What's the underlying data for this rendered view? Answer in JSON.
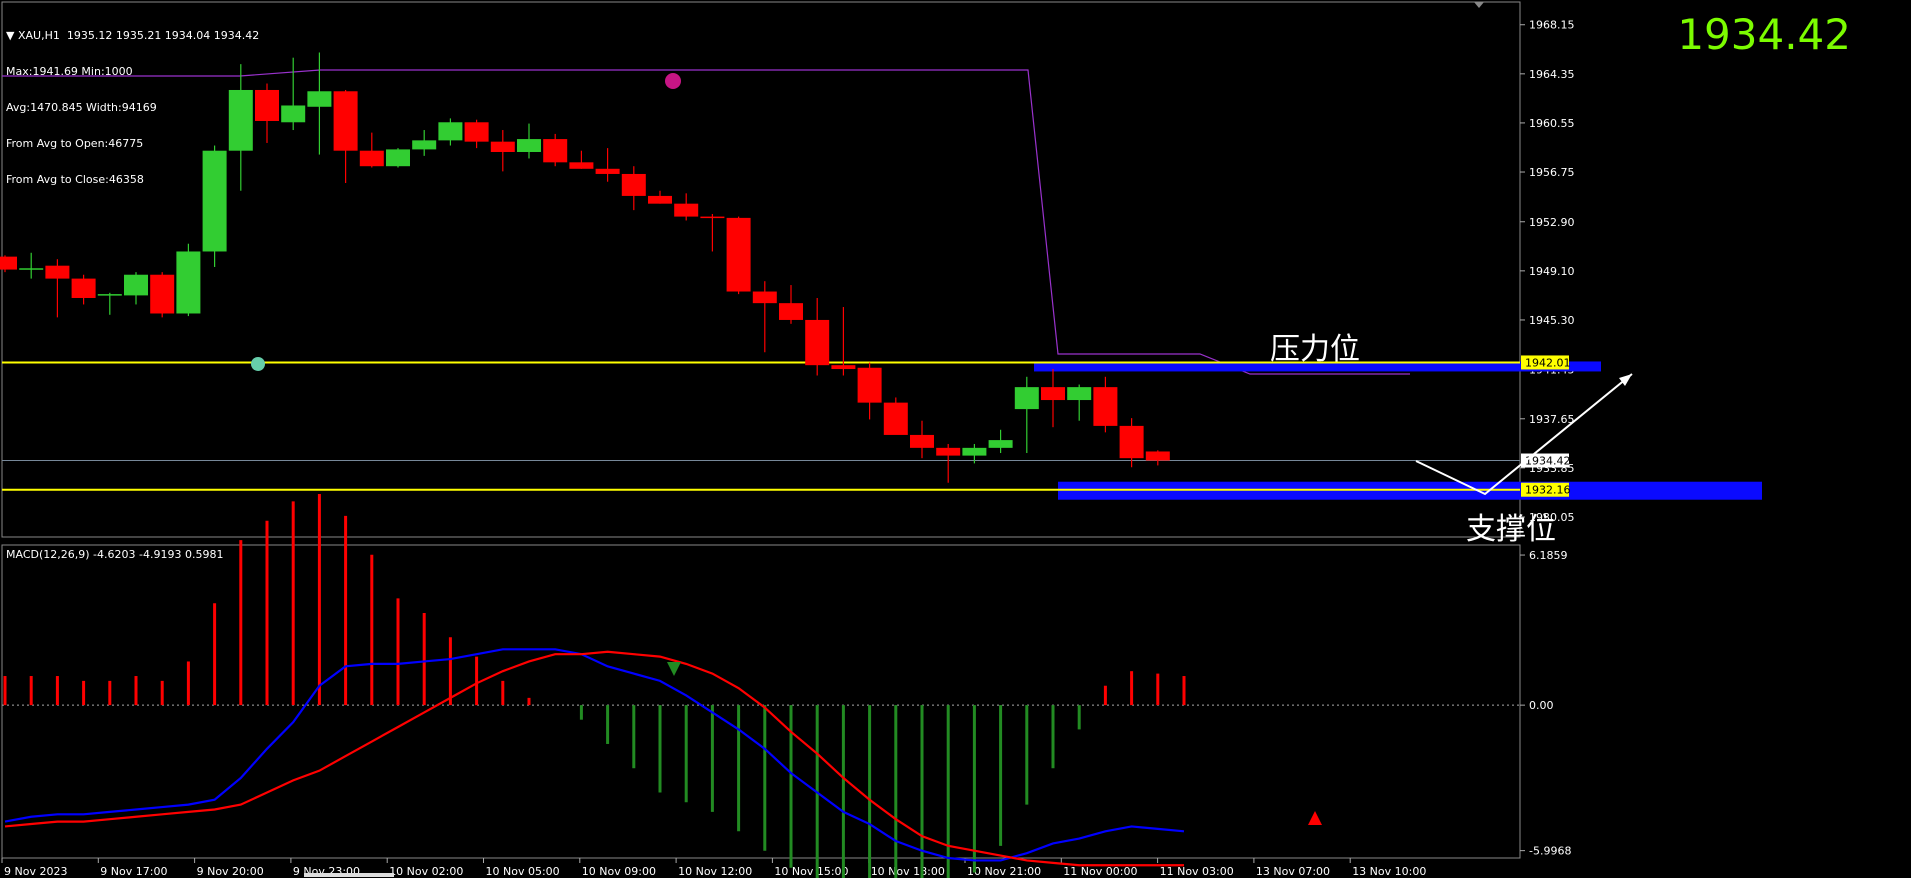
{
  "header": {
    "symbol_line": "XAU,H1  1935.12 1935.21 1934.04 1934.42",
    "lines": [
      "Max:1941.69 Min:1000",
      "Avg:1470.845 Width:94169",
      "From Avg to Open:46775",
      "From Avg to Close:46358"
    ]
  },
  "current_price": "1934.42",
  "annotations": {
    "resistance": "压力位",
    "support": "支撑位"
  },
  "macd_label": "MACD(12,26,9) -4.6203 -4.9193 0.5981",
  "colors": {
    "bull": "#32CD32",
    "bear": "#FF0000",
    "level": "#FFFF00",
    "zone": "#0A0AFF",
    "macd_main": "#0000FF",
    "macd_signal": "#FF0000",
    "big_price": "#7CFC00"
  },
  "chart_data": [
    {
      "type": "candlestick",
      "ylim": [
        1928.5,
        1969.6
      ],
      "y_ticks": [
        "1968.15",
        "1964.35",
        "1960.55",
        "1956.75",
        "1952.90",
        "1949.10",
        "1945.30",
        "1941.45",
        "1937.65",
        "1933.85",
        "1930.05"
      ],
      "x_labels": [
        "9 Nov 2023",
        "9 Nov 17:00",
        "9 Nov 20:00",
        "9 Nov 23:00",
        "10 Nov 02:00",
        "10 Nov 05:00",
        "10 Nov 09:00",
        "10 Nov 12:00",
        "10 Nov 15:00",
        "10 Nov 18:00",
        "10 Nov 21:00",
        "11 Nov 00:00",
        "11 Nov 03:00",
        "13 Nov 07:00",
        "13 Nov 10:00"
      ],
      "candles": [
        [
          1950.2,
          1950.3,
          1949.0,
          1949.2
        ],
        [
          1949.3,
          1950.5,
          1948.5,
          1949.3
        ],
        [
          1949.5,
          1950.0,
          1945.5,
          1948.5
        ],
        [
          1948.5,
          1948.8,
          1946.5,
          1947.0
        ],
        [
          1947.2,
          1947.4,
          1945.7,
          1947.3
        ],
        [
          1947.2,
          1949.0,
          1946.5,
          1948.8
        ],
        [
          1948.8,
          1949.0,
          1945.5,
          1945.8
        ],
        [
          1945.8,
          1951.2,
          1945.6,
          1950.6
        ],
        [
          1950.6,
          1958.8,
          1949.4,
          1958.4
        ],
        [
          1958.4,
          1965.1,
          1955.3,
          1963.1
        ],
        [
          1963.1,
          1963.6,
          1959.0,
          1960.7
        ],
        [
          1960.6,
          1965.6,
          1960.0,
          1961.9
        ],
        [
          1961.8,
          1966.0,
          1958.1,
          1963.0
        ],
        [
          1963.0,
          1963.1,
          1955.9,
          1958.4
        ],
        [
          1958.4,
          1959.8,
          1957.1,
          1957.2
        ],
        [
          1957.2,
          1958.6,
          1957.1,
          1958.5
        ],
        [
          1958.5,
          1960.0,
          1958.0,
          1959.2
        ],
        [
          1959.2,
          1960.9,
          1958.8,
          1960.6
        ],
        [
          1960.6,
          1960.8,
          1958.6,
          1959.1
        ],
        [
          1959.1,
          1960.0,
          1956.8,
          1958.3
        ],
        [
          1958.3,
          1960.5,
          1957.8,
          1959.3
        ],
        [
          1959.3,
          1959.7,
          1957.2,
          1957.5
        ],
        [
          1957.5,
          1958.4,
          1957.0,
          1957.0
        ],
        [
          1957.0,
          1958.6,
          1956.0,
          1956.6
        ],
        [
          1956.6,
          1957.2,
          1953.8,
          1954.9
        ],
        [
          1954.9,
          1955.3,
          1954.3,
          1954.3
        ],
        [
          1954.3,
          1955.1,
          1953.0,
          1953.3
        ],
        [
          1953.3,
          1953.5,
          1950.6,
          1953.2
        ],
        [
          1953.2,
          1953.3,
          1947.3,
          1947.5
        ],
        [
          1947.5,
          1948.3,
          1942.8,
          1946.6
        ],
        [
          1946.6,
          1948.0,
          1945.0,
          1945.3
        ],
        [
          1945.3,
          1947.0,
          1941.0,
          1941.8
        ],
        [
          1941.8,
          1946.3,
          1941.0,
          1941.5
        ],
        [
          1941.6,
          1942.0,
          1937.6,
          1938.9
        ],
        [
          1938.9,
          1939.3,
          1936.6,
          1936.4
        ],
        [
          1936.4,
          1937.5,
          1934.6,
          1935.4
        ],
        [
          1935.4,
          1935.7,
          1932.7,
          1934.8
        ],
        [
          1934.8,
          1935.7,
          1934.2,
          1935.4
        ],
        [
          1935.4,
          1936.8,
          1935.0,
          1936.0
        ],
        [
          1938.4,
          1940.9,
          1935.0,
          1940.1
        ],
        [
          1940.1,
          1941.5,
          1937.0,
          1939.1
        ],
        [
          1939.1,
          1940.3,
          1937.5,
          1940.1
        ],
        [
          1940.1,
          1940.9,
          1936.6,
          1937.1
        ],
        [
          1937.1,
          1937.7,
          1933.9,
          1934.6
        ],
        [
          1935.12,
          1935.21,
          1934.04,
          1934.42
        ]
      ],
      "hlines": [
        {
          "price": 1942.01,
          "label": "1942.01"
        },
        {
          "price": 1932.16,
          "label": "1932.16"
        }
      ],
      "bid_label": "1934.42"
    },
    {
      "type": "macd",
      "ylim": [
        -6.3,
        6.6
      ],
      "y_ticks": [
        "6.1859",
        "0.00",
        "-5.9968"
      ],
      "histogram": [
        1.2,
        1.2,
        1.2,
        1.0,
        1.0,
        1.2,
        1.0,
        1.8,
        4.2,
        6.8,
        7.6,
        8.4,
        8.7,
        7.8,
        6.2,
        4.4,
        3.8,
        2.8,
        2.0,
        1.0,
        0.3,
        0.0,
        -0.6,
        -1.6,
        -2.6,
        -3.6,
        -4.0,
        -4.4,
        -5.2,
        -6.0,
        -6.7,
        -7.2,
        -7.6,
        -7.8,
        -8.2,
        -8.4,
        -8.0,
        -6.9,
        -5.8,
        -4.1,
        -2.6,
        -1.0,
        0.8,
        1.4,
        1.3,
        1.2
      ],
      "main": [
        -4.8,
        -4.6,
        -4.5,
        -4.5,
        -4.4,
        -4.3,
        -4.2,
        -4.1,
        -3.9,
        -3.0,
        -1.8,
        -0.7,
        0.8,
        1.6,
        1.7,
        1.7,
        1.8,
        1.9,
        2.1,
        2.3,
        2.3,
        2.3,
        2.1,
        1.6,
        1.3,
        1.0,
        0.4,
        -0.3,
        -1.0,
        -1.8,
        -2.8,
        -3.6,
        -4.4,
        -4.9,
        -5.6,
        -6.0,
        -6.3,
        -6.4,
        -6.4,
        -6.1,
        -5.7,
        -5.5,
        -5.2,
        -5.0,
        -5.1,
        -5.2
      ],
      "signal": [
        -5.0,
        -4.9,
        -4.8,
        -4.8,
        -4.7,
        -4.6,
        -4.5,
        -4.4,
        -4.3,
        -4.1,
        -3.6,
        -3.1,
        -2.7,
        -2.1,
        -1.5,
        -0.9,
        -0.3,
        0.3,
        0.9,
        1.4,
        1.8,
        2.1,
        2.1,
        2.2,
        2.1,
        2.0,
        1.7,
        1.3,
        0.7,
        -0.1,
        -1.1,
        -2.0,
        -3.0,
        -3.9,
        -4.7,
        -5.4,
        -5.8,
        -6.0,
        -6.2,
        -6.4,
        -6.5,
        -6.6,
        -6.6,
        -6.6,
        -6.6,
        -6.6
      ]
    }
  ]
}
